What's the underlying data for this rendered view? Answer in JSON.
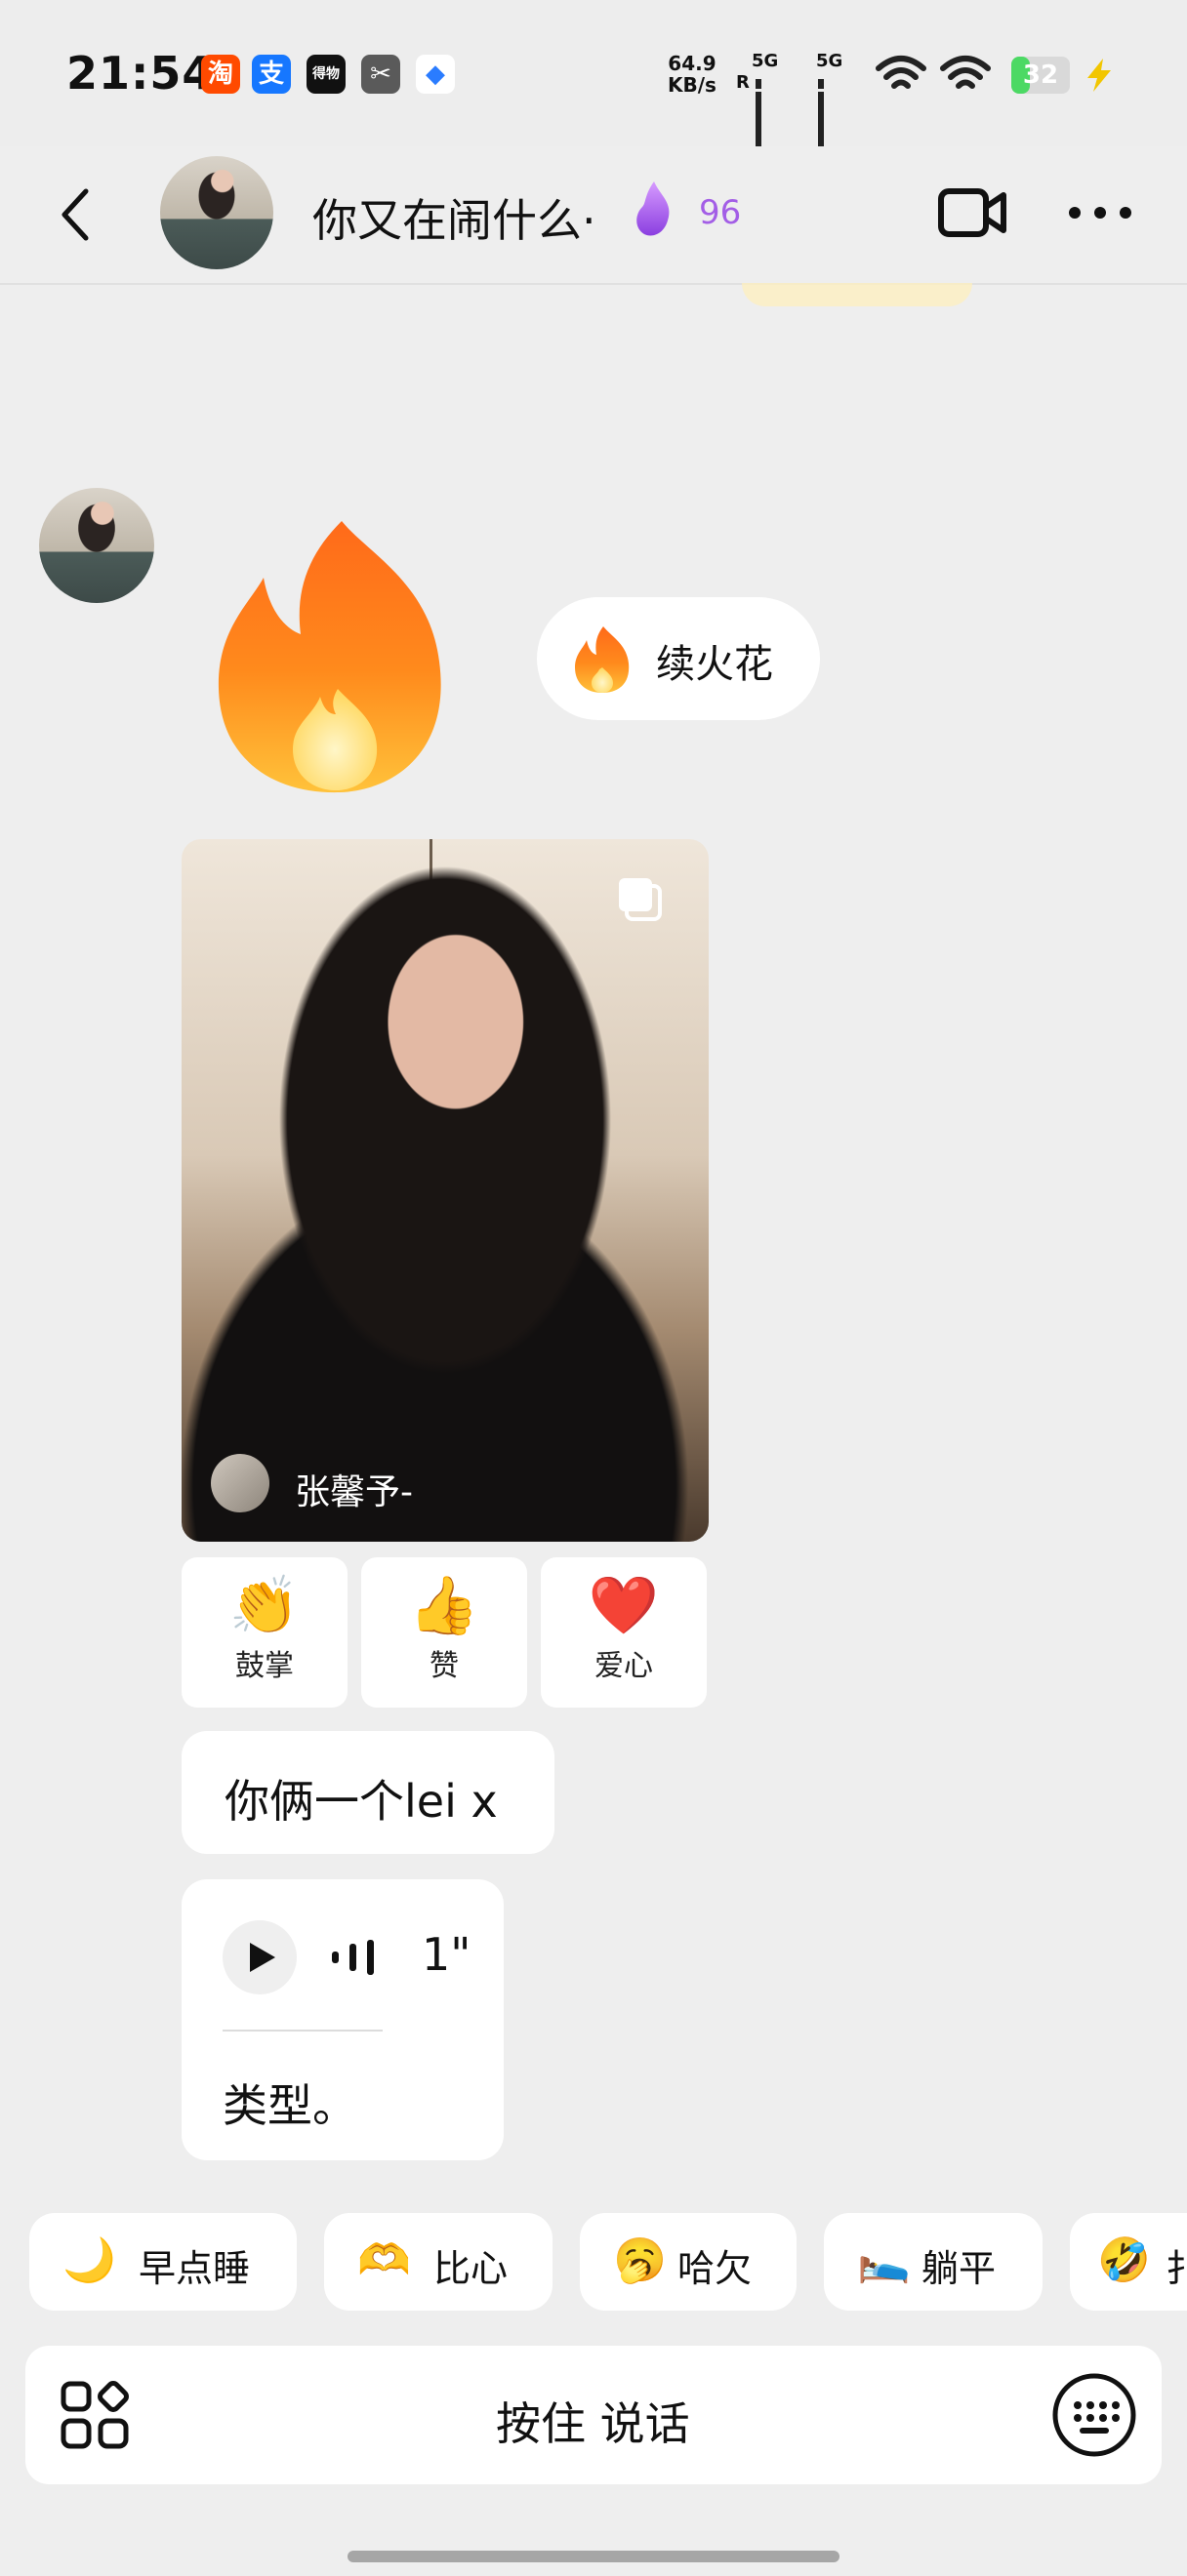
{
  "status_bar": {
    "time": "21:54",
    "net_speed_value": "64.9",
    "net_speed_unit": "KB/s",
    "signal_1": "5G",
    "signal_1_sub": "R",
    "signal_2": "5G",
    "battery": "32",
    "app_icons": [
      {
        "name": "taobao-icon",
        "glyph": "淘",
        "color": "#ff4a00"
      },
      {
        "name": "alipay-icon",
        "glyph": "支",
        "color": "#1677ff"
      },
      {
        "name": "dewu-icon",
        "glyph": "得物",
        "color": "#111111"
      },
      {
        "name": "capcut-icon",
        "glyph": "✂",
        "color": "#5a5a5a"
      },
      {
        "name": "blue-app-icon",
        "glyph": "◆",
        "color": "#2a7cff"
      }
    ]
  },
  "header": {
    "title": "你又在闹什么·",
    "score": "96",
    "score_color": "#a35ee6"
  },
  "chat": {
    "fire_label": "续火花",
    "photo_author": "张馨予-",
    "reactions": [
      {
        "emoji": "👏",
        "label": "鼓掌"
      },
      {
        "emoji": "👍",
        "label": "赞"
      },
      {
        "emoji": "❤️",
        "label": "爱心"
      }
    ],
    "text_message": "你俩一个lei x",
    "voice_duration": "1\"",
    "voice_transcript": "类型。"
  },
  "quick_replies": [
    {
      "emoji": "🌙",
      "label": "早点睡"
    },
    {
      "emoji": "🫶",
      "label": "比心"
    },
    {
      "emoji": "🥱",
      "label": "哈欠"
    },
    {
      "emoji": "🛌",
      "label": "躺平"
    },
    {
      "emoji": "🤣",
      "label": "扌"
    }
  ],
  "input_bar": {
    "hold_to_talk": "按住 说话"
  }
}
